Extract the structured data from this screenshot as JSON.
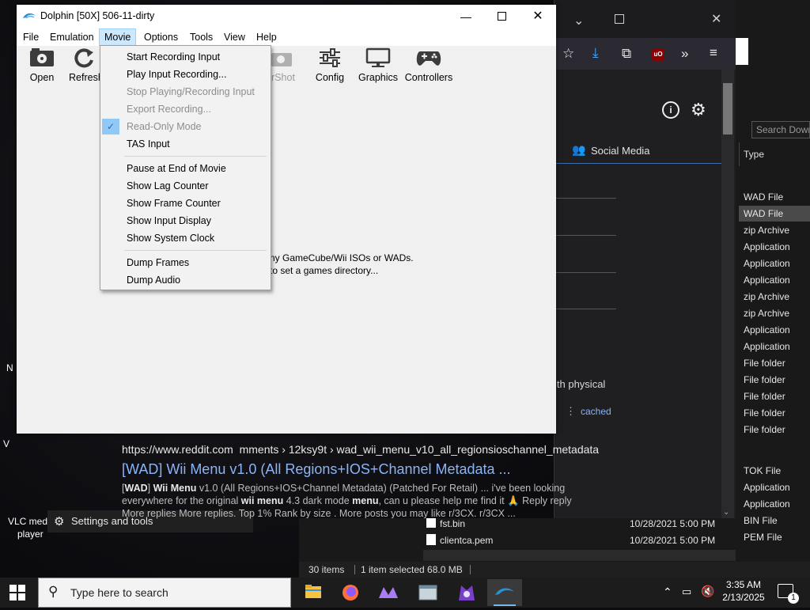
{
  "dolphin": {
    "title": "Dolphin [50X] 506-11-dirty",
    "menu": [
      "File",
      "Emulation",
      "Movie",
      "Options",
      "Tools",
      "View",
      "Help"
    ],
    "toolbar": {
      "open": "Open",
      "refresh": "Refresh",
      "screenshot": "rShot",
      "config": "Config",
      "graphics": "Graphics",
      "controllers": "Controllers"
    },
    "content_line1": "ny GameCube/Wii ISOs or WADs.",
    "content_line2": "to set a games directory..."
  },
  "movie_menu": {
    "items": [
      {
        "label": "Start Recording Input",
        "enabled": true
      },
      {
        "label": "Play Input Recording...",
        "enabled": true
      },
      {
        "label": "Stop Playing/Recording Input",
        "enabled": false
      },
      {
        "label": "Export Recording...",
        "enabled": false
      },
      {
        "label": "Read-Only Mode",
        "enabled": false,
        "checked": true
      },
      {
        "label": "TAS Input",
        "enabled": true
      },
      {
        "label": "Pause at End of Movie",
        "enabled": true
      },
      {
        "label": "Show Lag Counter",
        "enabled": true
      },
      {
        "label": "Show Frame Counter",
        "enabled": true
      },
      {
        "label": "Show Input Display",
        "enabled": true
      },
      {
        "label": "Show System Clock",
        "enabled": true
      },
      {
        "label": "Dump Frames",
        "enabled": true
      },
      {
        "label": "Dump Audio",
        "enabled": true
      }
    ]
  },
  "browser": {
    "social_media": "Social Media",
    "physical": "ith physical",
    "cached": "cached",
    "result": {
      "url": "https://www.reddit.com  mments › 12ksy9t › wad_wii_menu_v10_all_regionsioschannel_metadata",
      "title": "[WAD] Wii Menu v1.0 (All Regions+IOS+Channel Metadata ...",
      "snippet_line1_a": "[",
      "snippet_line1_b": "WAD",
      "snippet_line1_c": "] ",
      "snippet_line1_d": "Wii Menu",
      "snippet_line1_e": " v1.0 (All Regions+IOS+Channel Metadata) (Patched For Retail) ... i've been looking",
      "snippet_line2_a": "everywhere for the original ",
      "snippet_line2_b": "wii menu",
      "snippet_line2_c": " 4.3 dark mode ",
      "snippet_line2_d": "menu",
      "snippet_line2_e": ", can u please help me find it 🙏 Reply reply",
      "snippet_line3": "More replies More replies. Top 1% Rank by size . More posts you may like r/3CX. r/3CX ..."
    }
  },
  "explorer": {
    "search_placeholder": "Search Down",
    "type_header": "Type",
    "types": [
      "WAD File",
      "WAD File",
      "zip Archive",
      "Application",
      "Application",
      "Application",
      "zip Archive",
      "zip Archive",
      "Application",
      "Application",
      "File folder",
      "File folder",
      "File folder",
      "File folder",
      "File folder"
    ],
    "types_lower": [
      "TOK File",
      "Application",
      "Application",
      "BIN File",
      "PEM File"
    ],
    "files": [
      {
        "name": "fst.bin",
        "date": "10/28/2021 5:00 PM"
      },
      {
        "name": "clientca.pem",
        "date": "10/28/2021 5:00 PM"
      }
    ],
    "status_items": "30 items",
    "status_selected": "1 item selected  68.0 MB"
  },
  "desktop": {
    "vlc_label_1": "VLC medi",
    "vlc_label_2": "player",
    "settings_label": "Settings and tools",
    "edge_letter_1": "N",
    "edge_letter_2": "V"
  },
  "taskbar": {
    "search_text": "Type here to search",
    "time": "3:35 AM",
    "date": "2/13/2025",
    "notification_count": "1"
  }
}
